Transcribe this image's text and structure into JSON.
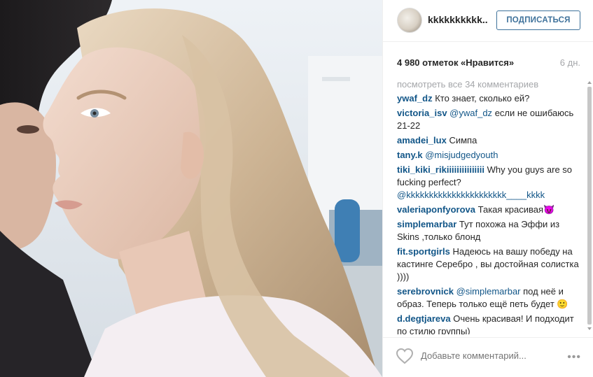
{
  "post": {
    "username": "kkkkkkkkkk..",
    "follow_label": "ПОДПИСАТЬСЯ",
    "likes": "4 980 отметок «Нравится»",
    "age": "6 дн.",
    "view_all": "посмотреть все 34 комментариев",
    "add_comment_placeholder": "Добавьте комментарий...",
    "more_icon": "•••"
  },
  "comments": [
    {
      "user": "ywaf_dz",
      "mention": "",
      "text": "Кто знает, сколько ей?"
    },
    {
      "user": "victoria_isv",
      "mention": "@ywaf_dz",
      "text": "если не ошибаюсь 21-22"
    },
    {
      "user": "amadei_lux",
      "mention": "",
      "text": "Симпа"
    },
    {
      "user": "tany.k",
      "mention": "@misjudgedyouth",
      "text": ""
    },
    {
      "user": "tiki_kiki_rikiiiiiiiiiiiiiii",
      "mention": "",
      "text": "Why you guys are so fucking perfect? "
    },
    {
      "user": "valeriaponfyorova",
      "mention": "",
      "text": "Такая красивая😈"
    },
    {
      "user": "simplemarbar",
      "mention": "",
      "text": "Тут похожа на Эффи из Skins ,только блонд"
    },
    {
      "user": "fit.sportgirls",
      "mention": "",
      "text": "Надеюсь на вашу победу на кастинге Серебро , вы достойная солистка ))))"
    },
    {
      "user": "serebrovnick",
      "mention": "@simplemarbar",
      "text": "под неё и образ. Теперь только ещё петь будет 🙂"
    },
    {
      "user": "d.degtjareva",
      "mention": "",
      "text": "Очень красивая! И подходит по стилю группы)"
    }
  ],
  "mention_line": "@kkkkkkkkkkkkkkkkkkkkkk____kkkk",
  "colors": {
    "link": "#125688",
    "follow_border": "#3f729b",
    "muted": "#a5a7aa"
  }
}
